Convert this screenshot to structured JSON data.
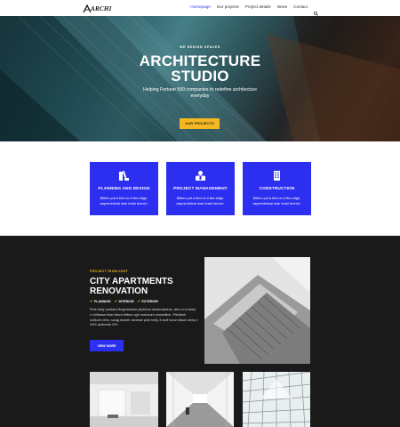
{
  "nav": {
    "logo_text": "ARCHI",
    "items": [
      "Homepage",
      "Our projects",
      "Project details",
      "News",
      "Contact"
    ],
    "active_index": 0
  },
  "hero": {
    "eyebrow": "WE DESIGN SPACES",
    "title_line1": "ARCHITECTURE",
    "title_line2": "STUDIO",
    "subtitle": "Helping Fortune 500 companies to redefine architecture everyday",
    "button_label": "OUR PROJECTS"
  },
  "services": [
    {
      "icon": "design-tools-icon",
      "title": "PLANNING AND DESIGN",
      "description": "Bitters put a bird on it live-edge, asymmetrical man braid brunch."
    },
    {
      "icon": "manager-icon",
      "title": "PROJECT MANAGEMENT",
      "description": "Bitters put a bird on it live-edge, asymmetrical man braid brunch."
    },
    {
      "icon": "building-icon",
      "title": "CONSTRUCTION",
      "description": "Bitters put a bird on it live-edge, asymmetrical man braid brunch."
    }
  ],
  "project": {
    "eyebrow": "PROJECT HIGHLIGHT",
    "title_line1": "CITY APARTMENTS",
    "title_line2": "RENOVATION",
    "tags": [
      "PLANNING",
      "INTERIOR",
      "EXTERIOR"
    ],
    "description": "Pork belly portland fingerstache pitchfork dreamcatcher, retro lo-fi deep v chillwave fixie kitsch bitters ugh normcore shoreditch. Pitchfork vollkorn retro, swag master cleanse pork belly 3 wolf moon kitsch deep v VHS authentic DIY.",
    "button_label": "VIEW MORE"
  },
  "colors": {
    "accent_blue": "#2c2ff0",
    "accent_yellow": "#f5b820",
    "dark_bg": "#1a1a1a"
  }
}
